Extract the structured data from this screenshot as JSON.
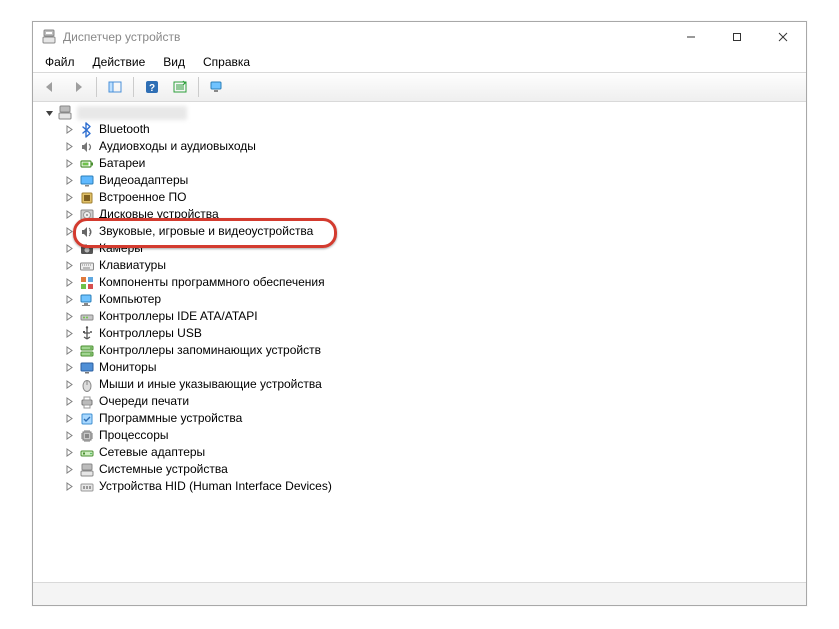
{
  "window": {
    "title": "Диспетчер устройств"
  },
  "menu": {
    "file": "Файл",
    "action": "Действие",
    "view": "Вид",
    "help": "Справка"
  },
  "tree": {
    "root_label_hidden": true,
    "categories": [
      {
        "icon": "bluetooth",
        "label": "Bluetooth"
      },
      {
        "icon": "audio-io",
        "label": "Аудиовходы и аудиовыходы"
      },
      {
        "icon": "battery",
        "label": "Батареи"
      },
      {
        "icon": "display",
        "label": "Видеоадаптеры"
      },
      {
        "icon": "firmware",
        "label": "Встроенное ПО"
      },
      {
        "icon": "disk",
        "label": "Дисковые устройства"
      },
      {
        "icon": "sound",
        "label": "Звуковые, игровые и видеоустройства",
        "highlighted": true
      },
      {
        "icon": "camera",
        "label": "Камеры"
      },
      {
        "icon": "keyboard",
        "label": "Клавиатуры"
      },
      {
        "icon": "software",
        "label": "Компоненты программного обеспечения"
      },
      {
        "icon": "computer",
        "label": "Компьютер"
      },
      {
        "icon": "ide",
        "label": "Контроллеры IDE ATA/ATAPI"
      },
      {
        "icon": "usb",
        "label": "Контроллеры USB"
      },
      {
        "icon": "storage",
        "label": "Контроллеры запоминающих устройств"
      },
      {
        "icon": "monitor",
        "label": "Мониторы"
      },
      {
        "icon": "mouse",
        "label": "Мыши и иные указывающие устройства"
      },
      {
        "icon": "printqueue",
        "label": "Очереди печати"
      },
      {
        "icon": "swdevice",
        "label": "Программные устройства"
      },
      {
        "icon": "cpu",
        "label": "Процессоры"
      },
      {
        "icon": "network",
        "label": "Сетевые адаптеры"
      },
      {
        "icon": "system",
        "label": "Системные устройства"
      },
      {
        "icon": "hid",
        "label": "Устройства HID (Human Interface Devices)"
      }
    ]
  },
  "highlight_color": "#d33b2f"
}
